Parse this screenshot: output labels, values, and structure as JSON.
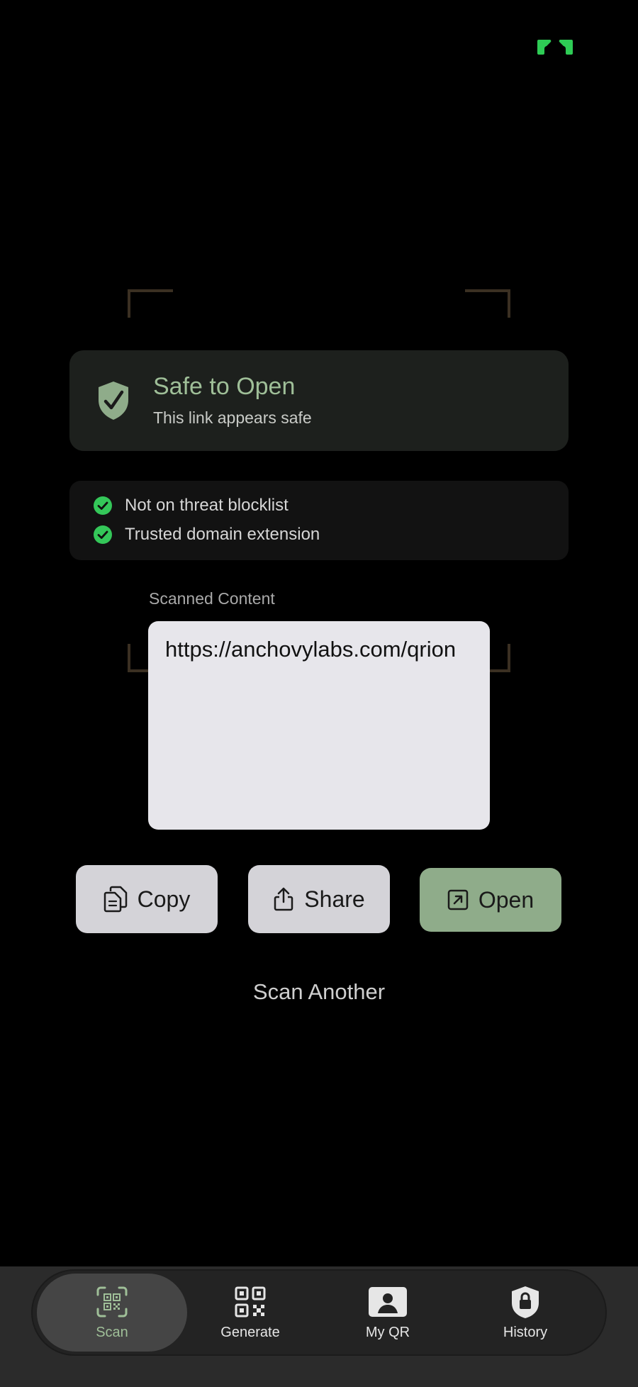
{
  "colors": {
    "accent": "#9fbf98",
    "accent_button": "#8fac8a",
    "check_green": "#34c759",
    "card_bg": "#1d201d",
    "background": "#000000"
  },
  "safety": {
    "title": "Safe to Open",
    "subtitle": "This link appears safe",
    "icon": "shield-check-icon"
  },
  "checks": [
    {
      "label": "Not on threat blocklist",
      "icon": "check-circle-icon"
    },
    {
      "label": "Trusted domain extension",
      "icon": "check-circle-icon"
    }
  ],
  "content": {
    "label": "Scanned Content",
    "value": "https://anchovylabs.com/qrion"
  },
  "actions": {
    "copy": {
      "label": "Copy",
      "icon": "copy-icon"
    },
    "share": {
      "label": "Share",
      "icon": "share-icon"
    },
    "open": {
      "label": "Open",
      "icon": "open-external-icon"
    }
  },
  "scan_another": "Scan Another",
  "nav": {
    "items": [
      {
        "label": "Scan",
        "icon": "qr-scan-icon",
        "active": true
      },
      {
        "label": "Generate",
        "icon": "qr-code-icon",
        "active": false
      },
      {
        "label": "My QR",
        "icon": "person-card-icon",
        "active": false
      },
      {
        "label": "History",
        "icon": "lock-shield-icon",
        "active": false
      }
    ]
  }
}
